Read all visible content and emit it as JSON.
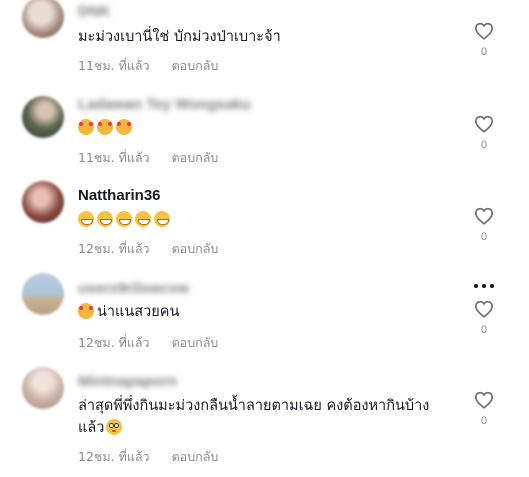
{
  "comments": [
    {
      "username": "DNK",
      "text": "มะม่วงเบานี่ใช่ บักม่วงป่าเบาะจ้า",
      "time": "11ชม. ที่แล้ว",
      "reply": "ตอบกลับ",
      "likes": "0",
      "avatar_color": "#b9a79a"
    },
    {
      "username": "Ladawan Tey Wongsaku",
      "text": "",
      "emoji": [
        "smiling-face-with-hearts",
        "smiling-face-with-hearts",
        "smiling-face-with-hearts"
      ],
      "time": "11ชม. ที่แล้ว",
      "reply": "ตอบกลับ",
      "likes": "0",
      "avatar_color": "#6f6a5a"
    },
    {
      "username": "Nattharin36",
      "text": "",
      "emoji": [
        "grinning-face",
        "grinning-face",
        "grinning-face",
        "grinning-face",
        "grinning-face"
      ],
      "time": "12ชม. ที่แล้ว",
      "reply": "ตอบกลับ",
      "likes": "0",
      "avatar_color": "#7a3f3a"
    },
    {
      "username": "userx9rilxwcvw",
      "text": "น่าแนสวยคน",
      "emoji": [
        "smiling-face-with-hearts"
      ],
      "time": "12ชม. ที่แล้ว",
      "reply": "ตอบกลับ",
      "likes": "0",
      "avatar_color": "#9fb6c9"
    },
    {
      "username": "Mintnapaporn",
      "text": "ล่าสุดพี่พึ่งกินมะม่วงกลืนน้ำลายตามเฉย คงต้องหากินบ้าง",
      "text_line2": "แล้ว",
      "emoji_after": [
        "flushed-face"
      ],
      "time": "12ชม. ที่แล้ว",
      "reply": "ตอบกลับ",
      "likes": "0",
      "avatar_color": "#cdb8ae"
    }
  ],
  "icons": {
    "like": "heart-outline-icon",
    "more": "more-options-icon"
  },
  "colors": {
    "text": "#161823",
    "meta": "#8a8b91",
    "background": "#ffffff"
  }
}
